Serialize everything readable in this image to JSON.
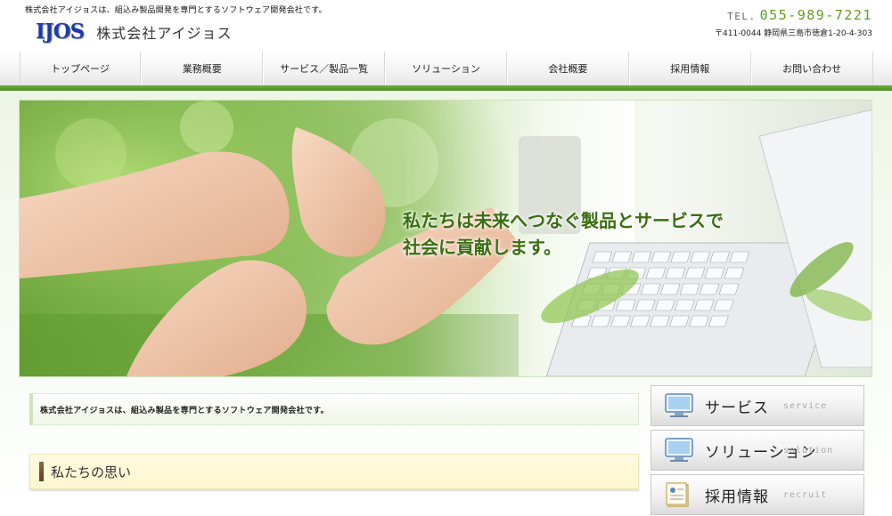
{
  "header": {
    "tagline": "株式会社アイジョスは、組込み製品開発を専門とするソフトウェア開発会社です。",
    "logo_mark": "IJOS",
    "logo_name": "株式会社アイジョス",
    "tel_prefix": "TEL.",
    "tel_number": "055-989-7221",
    "address": "〒411-0044 静岡県三島市徳倉1-20-4-303"
  },
  "nav": {
    "items": [
      {
        "label": "トップページ"
      },
      {
        "label": "業務概要"
      },
      {
        "label": "サービス／製品一覧"
      },
      {
        "label": "ソリューション"
      },
      {
        "label": "会社概要"
      },
      {
        "label": "採用情報"
      },
      {
        "label": "お問い合わせ"
      }
    ]
  },
  "hero": {
    "line1": "私たちは未来へつなぐ製品とサービスで",
    "line2": "社会に貢献します。"
  },
  "intro": {
    "text": "株式会社アイジョスは、組込み製品を専門とするソフトウェア開発会社です。"
  },
  "section": {
    "title": "私たちの思い"
  },
  "side": {
    "buttons": [
      {
        "label": "サービス",
        "sub": "service",
        "icon": "monitor-icon"
      },
      {
        "label": "ソリューション",
        "sub": "solution",
        "icon": "monitor-icon"
      },
      {
        "label": "採用情報",
        "sub": "recruit",
        "icon": "document-icon"
      }
    ]
  },
  "colors": {
    "accent_green": "#5f9b22",
    "logo_blue": "#1f3aa8"
  }
}
